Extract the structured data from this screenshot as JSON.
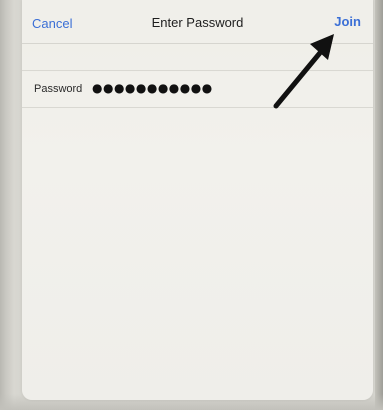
{
  "dialog": {
    "cancel_label": "Cancel",
    "title": "Enter Password",
    "join_label": "Join"
  },
  "form": {
    "password_label": "Password",
    "password_value": "●●●●●●●●●●●"
  },
  "colors": {
    "accent": "#3b6fd6",
    "sheet_background": "#f0efea",
    "annotation_arrow": "#111111"
  },
  "annotation": {
    "arrow_icon": "arrow-up-right-icon"
  }
}
